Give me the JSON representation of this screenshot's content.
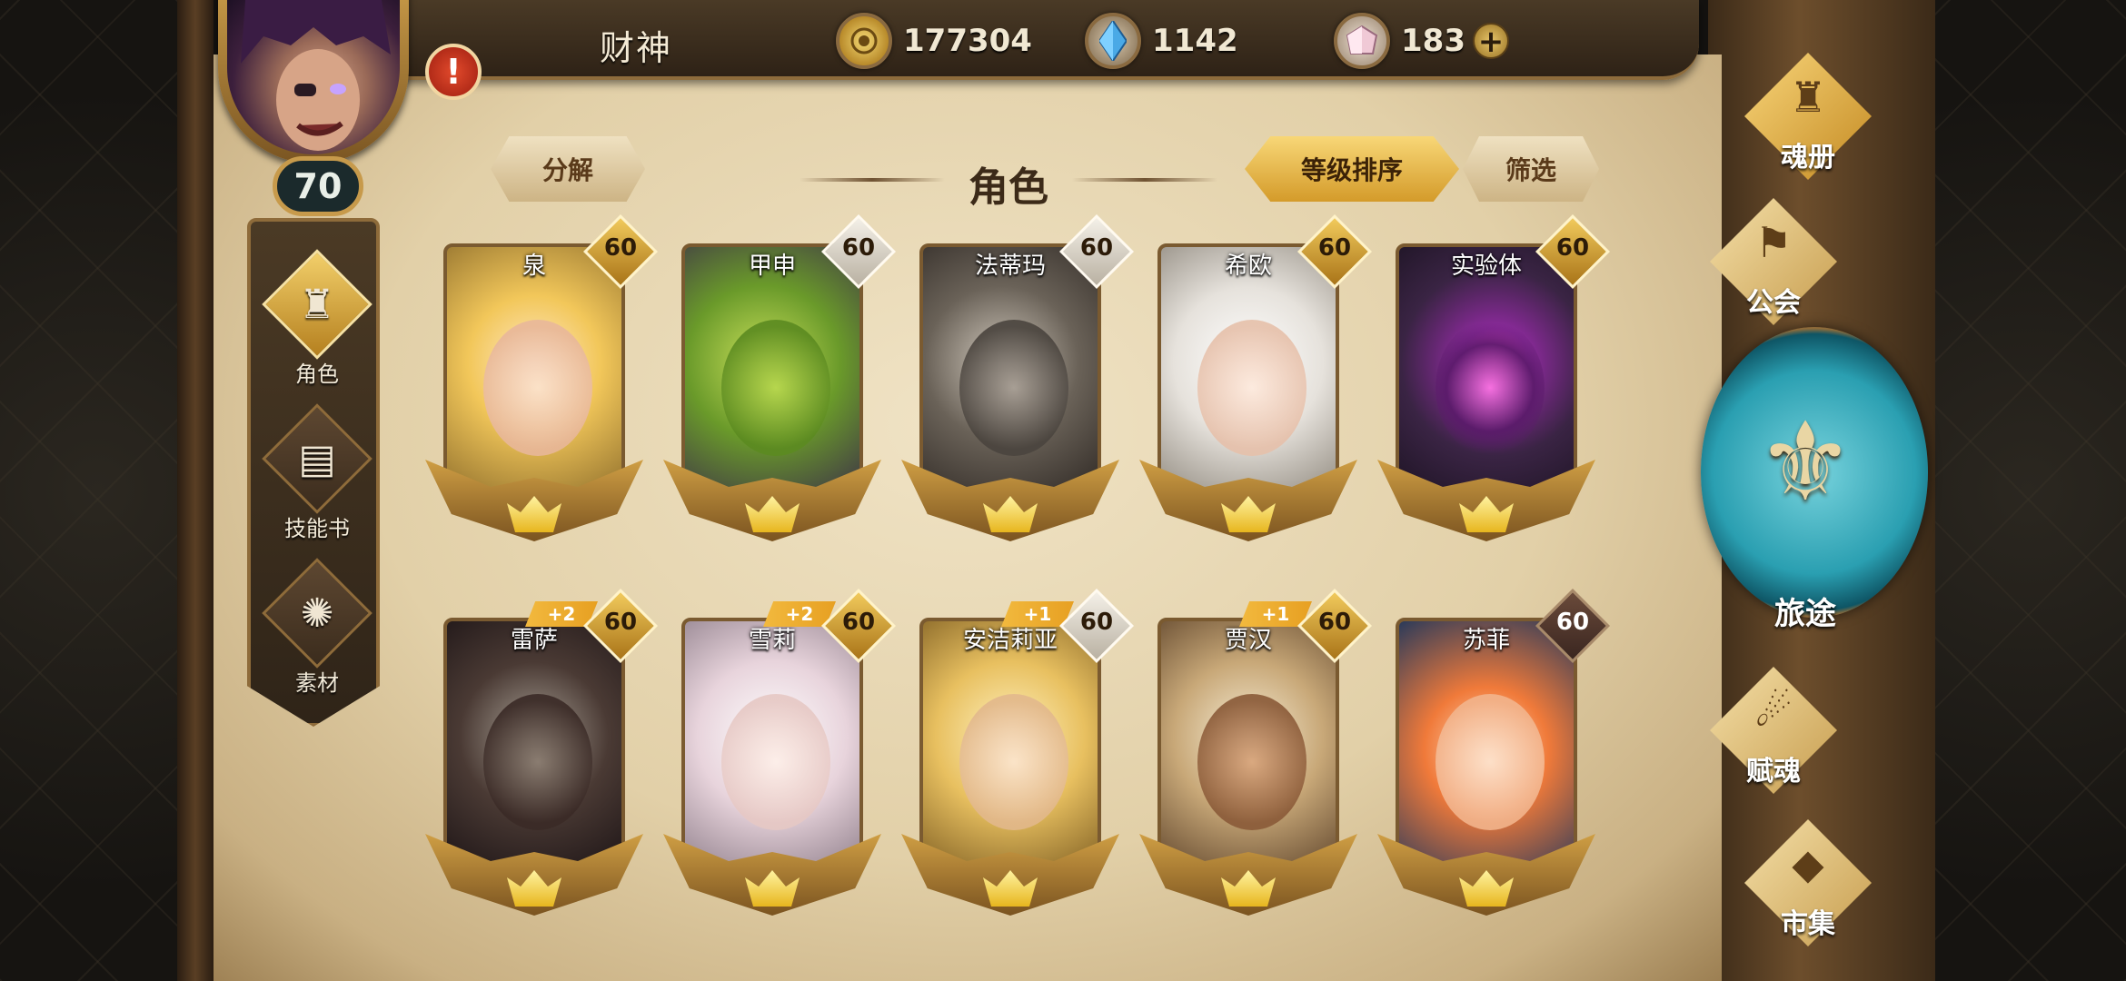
{
  "player": {
    "name": "财神",
    "level": "70",
    "alert": "!"
  },
  "resources": {
    "gold": "177304",
    "crystal": "1142",
    "gem": "183",
    "plus": "+"
  },
  "left_nav": [
    {
      "label": "角色",
      "icon": "helm-icon",
      "active": true
    },
    {
      "label": "技能书",
      "icon": "book-icon",
      "active": false
    },
    {
      "label": "素材",
      "icon": "beast-icon",
      "active": false
    }
  ],
  "header": {
    "title": "角色",
    "decompose": "分解",
    "sort": "等级排序",
    "filter": "筛选"
  },
  "characters": [
    {
      "name": "泉",
      "level": "60",
      "bonus": ""
    },
    {
      "name": "甲申",
      "level": "60",
      "bonus": ""
    },
    {
      "name": "法蒂玛",
      "level": "60",
      "bonus": ""
    },
    {
      "name": "希欧",
      "level": "60",
      "bonus": ""
    },
    {
      "name": "实验体",
      "level": "60",
      "bonus": ""
    },
    {
      "name": "雷萨",
      "level": "60",
      "bonus": "+2"
    },
    {
      "name": "雪莉",
      "level": "60",
      "bonus": "+2"
    },
    {
      "name": "安洁莉亚",
      "level": "60",
      "bonus": "+1"
    },
    {
      "name": "贾汉",
      "level": "60",
      "bonus": "+1"
    },
    {
      "name": "苏菲",
      "level": "60",
      "bonus": ""
    }
  ],
  "right_nav": {
    "soulbook": "魂册",
    "guild": "公会",
    "journey": "旅途",
    "endow": "赋魂",
    "market": "市集"
  },
  "colors": {
    "gold_accent": "#d9a748",
    "parchment": "#e2d0a8",
    "journey_teal": "#2a9fb1"
  }
}
